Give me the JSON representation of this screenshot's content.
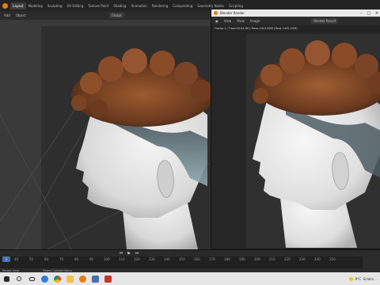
{
  "workspace_tabs": [
    "Layout",
    "Modeling",
    "Sculpting",
    "UV Editing",
    "Texture Paint",
    "Shading",
    "Animation",
    "Rendering",
    "Compositing",
    "Geometry Nodes",
    "Scripting"
  ],
  "viewport_header": {
    "menu": [
      "Add",
      "Object"
    ],
    "orientation_label": "Global"
  },
  "render_window": {
    "title": "Blender Render",
    "menu": [
      "View",
      "View",
      "Image"
    ],
    "slot_label": "Render Result",
    "stats": "Frame:1 | Time:00:04:90 | Mem:1413.60M (Peak 1492.20M)"
  },
  "timeline": {
    "current_frame": "1",
    "ticks": [
      "40",
      "50",
      "60",
      "70",
      "80",
      "90",
      "100",
      "110",
      "120",
      "130",
      "140",
      "150",
      "160",
      "170",
      "180",
      "190",
      "200",
      "210",
      "220",
      "230",
      "240",
      "250"
    ]
  },
  "status_bar": {
    "items": [
      "Rotate View",
      "Object Context Menu"
    ]
  },
  "taskbar": {
    "weather": "9°C",
    "weather_desc": "Eclairc..."
  },
  "icons": [
    "blender-logo-icon",
    "close-icon",
    "minimize-icon",
    "maximize-icon",
    "play-icon",
    "skip-back-icon",
    "skip-forward-icon",
    "windows-start-icon",
    "search-icon",
    "task-view-icon",
    "chrome-icon",
    "explorer-icon",
    "blender-icon"
  ],
  "colors": {
    "accent": "#e87d0d",
    "playhead": "#3f6fb0"
  }
}
